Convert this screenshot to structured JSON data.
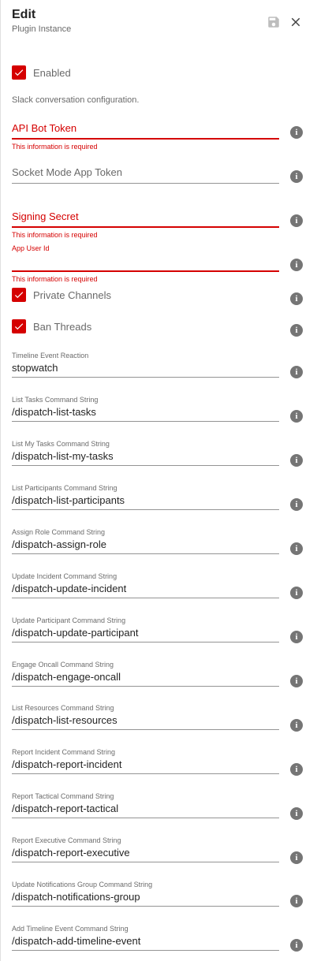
{
  "header": {
    "title": "Edit",
    "subtitle": "Plugin Instance"
  },
  "enabled": {
    "label": "Enabled",
    "checked": true
  },
  "description": "Slack conversation configuration.",
  "required_fields": {
    "api_bot_token": {
      "placeholder": "API Bot Token",
      "error": "This information is required"
    },
    "socket_mode_app_token": {
      "placeholder": "Socket Mode App Token"
    },
    "signing_secret": {
      "placeholder": "Signing Secret",
      "error": "This information is required"
    },
    "app_user_id": {
      "label": "App User Id",
      "error": "This information is required"
    }
  },
  "checkboxes": {
    "private_channels": {
      "label": "Private Channels",
      "checked": true
    },
    "ban_threads": {
      "label": "Ban Threads",
      "checked": true
    }
  },
  "fields": [
    {
      "label": "Timeline Event Reaction",
      "value": "stopwatch"
    },
    {
      "label": "List Tasks Command String",
      "value": "/dispatch-list-tasks"
    },
    {
      "label": "List My Tasks Command String",
      "value": "/dispatch-list-my-tasks"
    },
    {
      "label": "List Participants Command String",
      "value": "/dispatch-list-participants"
    },
    {
      "label": "Assign Role Command String",
      "value": "/dispatch-assign-role"
    },
    {
      "label": "Update Incident Command String",
      "value": "/dispatch-update-incident"
    },
    {
      "label": "Update Participant Command String",
      "value": "/dispatch-update-participant"
    },
    {
      "label": "Engage Oncall Command String",
      "value": "/dispatch-engage-oncall"
    },
    {
      "label": "List Resources Command String",
      "value": "/dispatch-list-resources"
    },
    {
      "label": "Report Incident Command String",
      "value": "/dispatch-report-incident"
    },
    {
      "label": "Report Tactical Command String",
      "value": "/dispatch-report-tactical"
    },
    {
      "label": "Report Executive Command String",
      "value": "/dispatch-report-executive"
    },
    {
      "label": "Update Notifications Group Command String",
      "value": "/dispatch-notifications-group"
    },
    {
      "label": "Add Timeline Event Command String",
      "value": "/dispatch-add-timeline-event"
    }
  ],
  "icons": {
    "save": "save-icon",
    "close": "close-icon",
    "info": "info-icon",
    "check": "check-icon"
  },
  "colors": {
    "accent": "#d50000",
    "info_icon": "#757575"
  }
}
